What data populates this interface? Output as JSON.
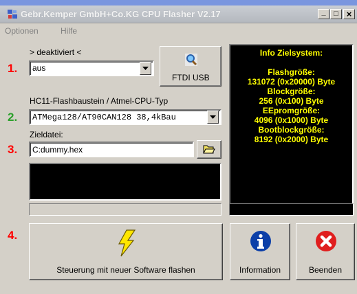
{
  "window": {
    "title": "Gebr.Kemper GmbH+Co.KG CPU Flasher V2.17",
    "minimize_glyph": "_",
    "maximize_glyph": "□",
    "close_glyph": "×"
  },
  "menu": {
    "items": [
      "Optionen",
      "Hilfe"
    ]
  },
  "steps": {
    "s1": "1.",
    "s2": "2.",
    "s3": "3.",
    "s4": "4."
  },
  "interface": {
    "status": "> deaktiviert <",
    "selected": "aus",
    "ftdi_button": "FTDI USB"
  },
  "cpu": {
    "label": "HC11-Flashbaustein / Atmel-CPU-Typ",
    "selected": "ATMega128/AT90CAN128 38,4kBau"
  },
  "target_file": {
    "label": "Zieldatei:",
    "value": "C:dummy.hex"
  },
  "info": {
    "title": "Info Zielsystem:",
    "flash_label": "Flashgröße:",
    "flash_value": "131072 (0x20000) Byte",
    "block_label": "Blockgröße:",
    "block_value": "256 (0x100) Byte",
    "eeprom_label": "EEpromgröße:",
    "eeprom_value": "4096 (0x1000) Byte",
    "bootblock_label": "Bootblockgröße:",
    "bootblock_value": "8192 (0x2000) Byte"
  },
  "buttons": {
    "flash": "Steuerung mit neuer Software flashen",
    "information": "Information",
    "exit": "Beenden"
  },
  "colors": {
    "step_red": "#ff0000",
    "step_green": "#2ba02b",
    "info_text": "#ffff00",
    "panel_bg": "#000000",
    "face": "#d4d0c8"
  },
  "icons": {
    "app": "app-icon",
    "ftdi": "magnifier-icon",
    "open": "folder-open-icon",
    "flash": "lightning-icon",
    "information": "info-icon",
    "exit": "close-icon"
  }
}
